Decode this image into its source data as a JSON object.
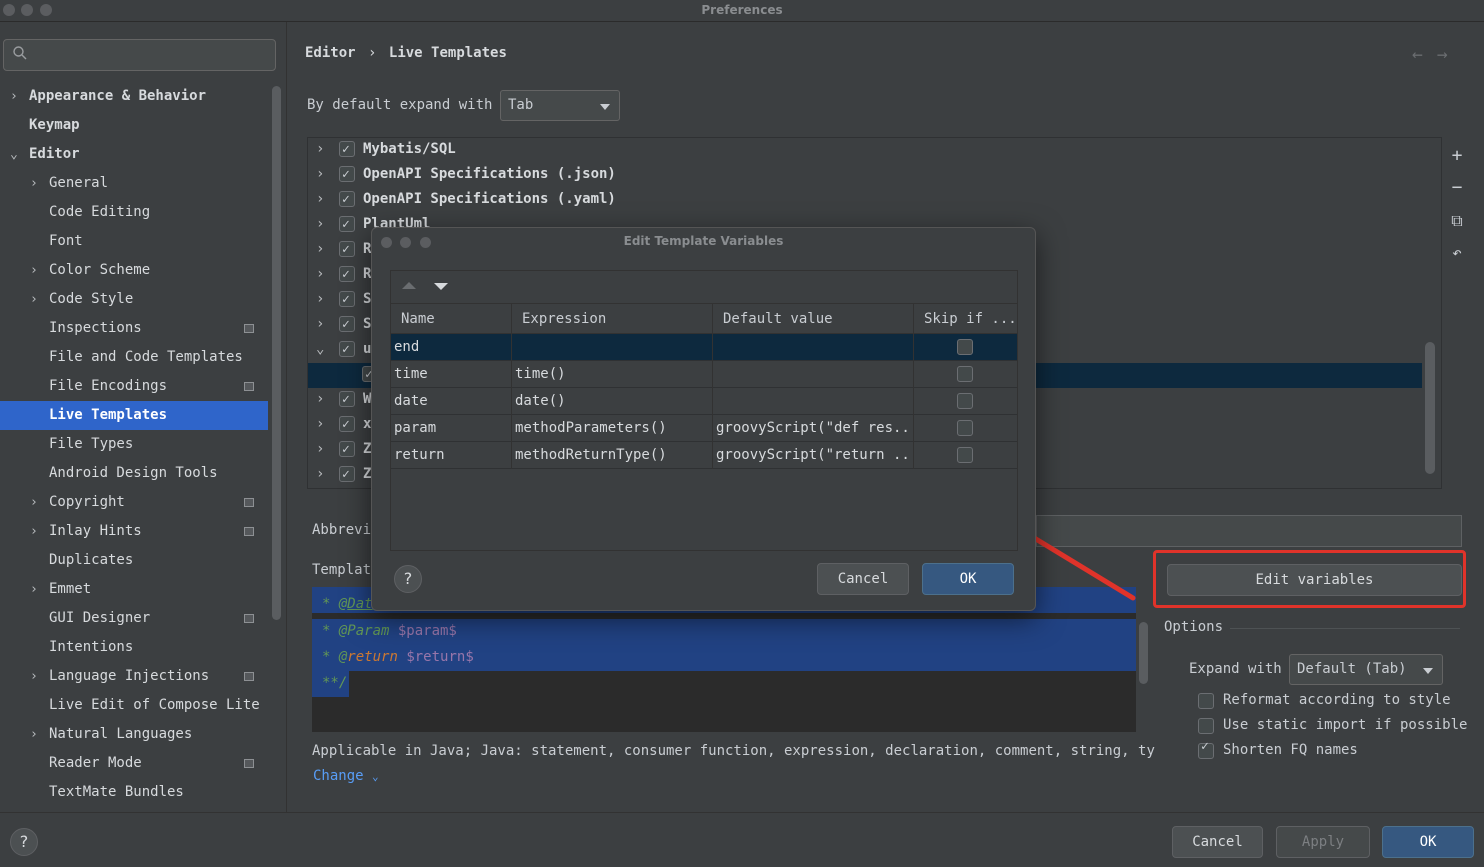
{
  "window": {
    "title": "Preferences"
  },
  "sidebar": {
    "search_placeholder": "",
    "items": [
      {
        "label": "Appearance & Behavior",
        "arrow": "›",
        "bold": true
      },
      {
        "label": "Keymap",
        "bold": true
      },
      {
        "label": "Editor",
        "arrow": "⌄",
        "bold": true
      },
      {
        "label": "General",
        "arrow": "›"
      },
      {
        "label": "Code Editing"
      },
      {
        "label": "Font"
      },
      {
        "label": "Color Scheme",
        "arrow": "›"
      },
      {
        "label": "Code Style",
        "arrow": "›"
      },
      {
        "label": "Inspections"
      },
      {
        "label": "File and Code Templates"
      },
      {
        "label": "File Encodings"
      },
      {
        "label": "Live Templates"
      },
      {
        "label": "File Types"
      },
      {
        "label": "Android Design Tools"
      },
      {
        "label": "Copyright",
        "arrow": "›"
      },
      {
        "label": "Inlay Hints",
        "arrow": "›"
      },
      {
        "label": "Duplicates"
      },
      {
        "label": "Emmet",
        "arrow": "›"
      },
      {
        "label": "GUI Designer"
      },
      {
        "label": "Intentions"
      },
      {
        "label": "Language Injections",
        "arrow": "›"
      },
      {
        "label": "Live Edit of Compose Lite"
      },
      {
        "label": "Natural Languages",
        "arrow": "›"
      },
      {
        "label": "Reader Mode"
      },
      {
        "label": "TextMate Bundles"
      }
    ]
  },
  "breadcrumb": {
    "root": "Editor",
    "sep": "›",
    "current": "Live Templates"
  },
  "expand": {
    "label": "By default expand with",
    "value": "Tab"
  },
  "tree": {
    "rows": [
      {
        "label": "Mybatis/SQL"
      },
      {
        "label": "OpenAPI Specifications (.json)"
      },
      {
        "label": "OpenAPI Specifications (.yaml)"
      },
      {
        "label": "PlantUml"
      },
      {
        "label": "R"
      },
      {
        "label": "R"
      },
      {
        "label": "S"
      },
      {
        "label": "S"
      },
      {
        "label": "u"
      },
      {
        "label": ""
      },
      {
        "label": "W"
      },
      {
        "label": "x"
      },
      {
        "label": "Z"
      },
      {
        "label": "Z"
      }
    ]
  },
  "abbrev_label": "Abbrevi",
  "template_label": "Templat",
  "code_lines": [
    {
      "prefix": "* @",
      "tag": "Dat",
      "rest": ""
    },
    {
      "prefix": "* @Param ",
      "var": "$param$"
    },
    {
      "prefix": "* @",
      "kw": "return",
      "mid": " ",
      "var": "$return$"
    },
    {
      "prefix": "**/"
    }
  ],
  "applicable": "Applicable in Java; Java: statement, consumer function, expression, declaration, comment, string, ty",
  "change_link": "Change",
  "edit_variables": "Edit variables",
  "options": {
    "title": "Options",
    "expand_label": "Expand with",
    "expand_value": "Default (Tab)",
    "reformat": "Reformat according to style",
    "static_import": "Use static import if possible",
    "shorten": "Shorten FQ names"
  },
  "footer": {
    "cancel": "Cancel",
    "apply": "Apply",
    "ok": "OK",
    "help": "?"
  },
  "dialog": {
    "title": "Edit Template Variables",
    "columns": [
      "Name",
      "Expression",
      "Default value",
      "Skip if ..."
    ],
    "rows": [
      {
        "name": "end",
        "expression": "",
        "default": ""
      },
      {
        "name": "time",
        "expression": "time()",
        "default": ""
      },
      {
        "name": "date",
        "expression": "date()",
        "default": ""
      },
      {
        "name": "param",
        "expression": "methodParameters()",
        "default": "groovyScript(\"def res..."
      },
      {
        "name": "return",
        "expression": "methodReturnType()",
        "default": "groovyScript(\"return ..."
      }
    ],
    "cancel": "Cancel",
    "ok": "OK",
    "help": "?"
  },
  "colors": {
    "accent": "#2f65ca",
    "annotation": "#e0332a"
  }
}
